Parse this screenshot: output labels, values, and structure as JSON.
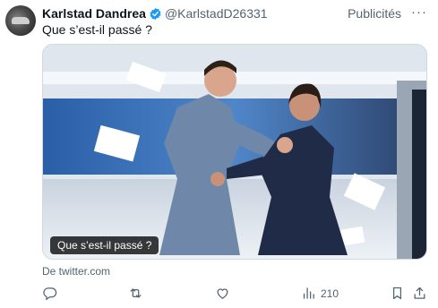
{
  "tweet": {
    "author_name": "Karlstad Dandrea",
    "author_handle": "@KarlstadD26331",
    "promoted_label": "Publicités",
    "more_label": "···",
    "text": "Que s’est-il passé ?",
    "media_caption": "Que s’est-il passé ?",
    "source_label": "De twitter.com"
  },
  "actions": {
    "views_count": "210"
  },
  "icons": [
    "verified-badge-icon",
    "more-icon",
    "reply-icon",
    "retweet-icon",
    "like-icon",
    "views-icon",
    "bookmark-icon",
    "share-icon"
  ],
  "colors": {
    "verified": "#1d9bf0",
    "muted": "#536471",
    "text": "#0f1419"
  }
}
